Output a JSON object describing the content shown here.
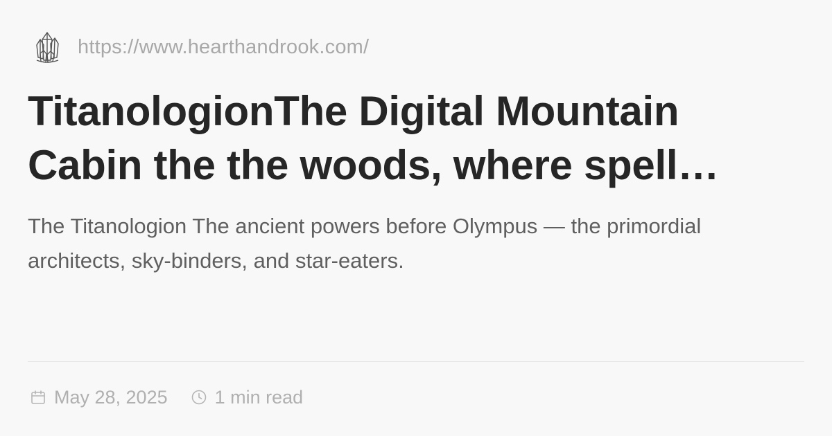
{
  "site": {
    "logo_icon": "crystal-cluster-icon",
    "url": "https://www.hearthandrook.com/"
  },
  "article": {
    "title": "TitanologionThe Digital Mountain Cabin the the woods, where spell…",
    "description": "The Titanologion The ancient powers before Olympus — the primordial architects, sky-binders, and star-eaters."
  },
  "meta": {
    "date_icon": "calendar-icon",
    "date": "May 28, 2025",
    "read_icon": "clock-icon",
    "read_time": "1 min read"
  },
  "colors": {
    "background": "#f9f8f8",
    "title": "#262626",
    "description": "#5f5f5f",
    "muted": "#a8a8a8",
    "divider": "#e6e5e5"
  }
}
